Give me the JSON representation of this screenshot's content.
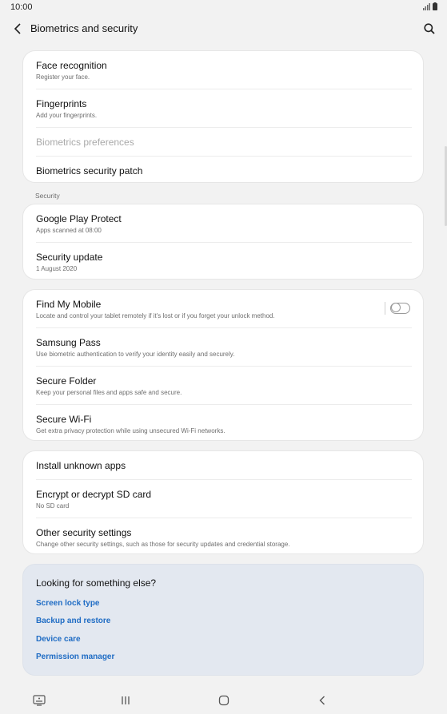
{
  "status": {
    "time": "10:00"
  },
  "header": {
    "title": "Biometrics and security"
  },
  "biometrics": {
    "face": {
      "title": "Face recognition",
      "sub": "Register your face."
    },
    "fingerprints": {
      "title": "Fingerprints",
      "sub": "Add your fingerprints."
    },
    "preferences": {
      "title": "Biometrics preferences"
    },
    "patch": {
      "title": "Biometrics security patch"
    }
  },
  "security_section": {
    "label": "Security"
  },
  "security": {
    "play_protect": {
      "title": "Google Play Protect",
      "sub": "Apps scanned at 08:00"
    },
    "update": {
      "title": "Security update",
      "sub": "1 August 2020"
    }
  },
  "services": {
    "find_my_mobile": {
      "title": "Find My Mobile",
      "sub": "Locate and control your tablet remotely if it's lost or if you forget your unlock method.",
      "enabled": false
    },
    "samsung_pass": {
      "title": "Samsung Pass",
      "sub": "Use biometric authentication to verify your identity easily and securely."
    },
    "secure_folder": {
      "title": "Secure Folder",
      "sub": "Keep your personal files and apps safe and secure."
    },
    "secure_wifi": {
      "title": "Secure Wi-Fi",
      "sub": "Get extra privacy protection while using unsecured Wi-Fi networks."
    }
  },
  "other": {
    "unknown_apps": {
      "title": "Install unknown apps"
    },
    "encrypt_sd": {
      "title": "Encrypt or decrypt SD card",
      "sub": "No SD card"
    },
    "other_settings": {
      "title": "Other security settings",
      "sub": "Change other security settings, such as those for security updates and credential storage."
    }
  },
  "suggestions": {
    "title": "Looking for something else?",
    "links": [
      "Screen lock type",
      "Backup and restore",
      "Device care",
      "Permission manager"
    ]
  },
  "colors": {
    "background": "#f2f2f2",
    "card": "#ffffff",
    "suggest_card": "#e3e8f0",
    "link": "#1f6cc4"
  },
  "icons": [
    "back-arrow-icon",
    "search-icon",
    "signal-icon",
    "battery-icon",
    "keyboard-icon",
    "recents-icon",
    "home-icon",
    "nav-back-icon"
  ]
}
